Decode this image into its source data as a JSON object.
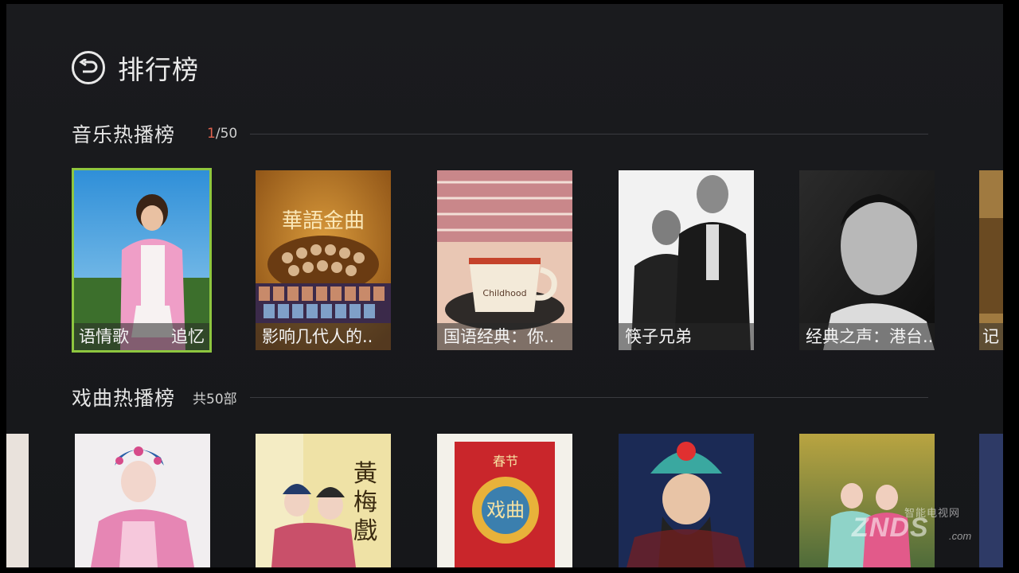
{
  "header": {
    "title": "排行榜",
    "back_icon": "back-arrow-circle-icon"
  },
  "music": {
    "title": "音乐热播榜",
    "counter_current": "1",
    "counter_total": "/50",
    "items": [
      {
        "caption_left": "语情歌",
        "caption_right": "追忆"
      },
      {
        "caption": "影响几代人的.."
      },
      {
        "caption": "国语经典：你.."
      },
      {
        "caption": "筷子兄弟"
      },
      {
        "caption": "经典之声：港台.."
      },
      {
        "caption": "记"
      }
    ]
  },
  "opera": {
    "title": "戏曲热播榜",
    "count": "共50部"
  },
  "watermark": {
    "top": "智能电视网",
    "main": "ZNDS",
    "domain": ".com"
  },
  "colors": {
    "focus": "#8ec63f",
    "counter_accent": "#e0634f",
    "background": "#1a1b1e"
  }
}
